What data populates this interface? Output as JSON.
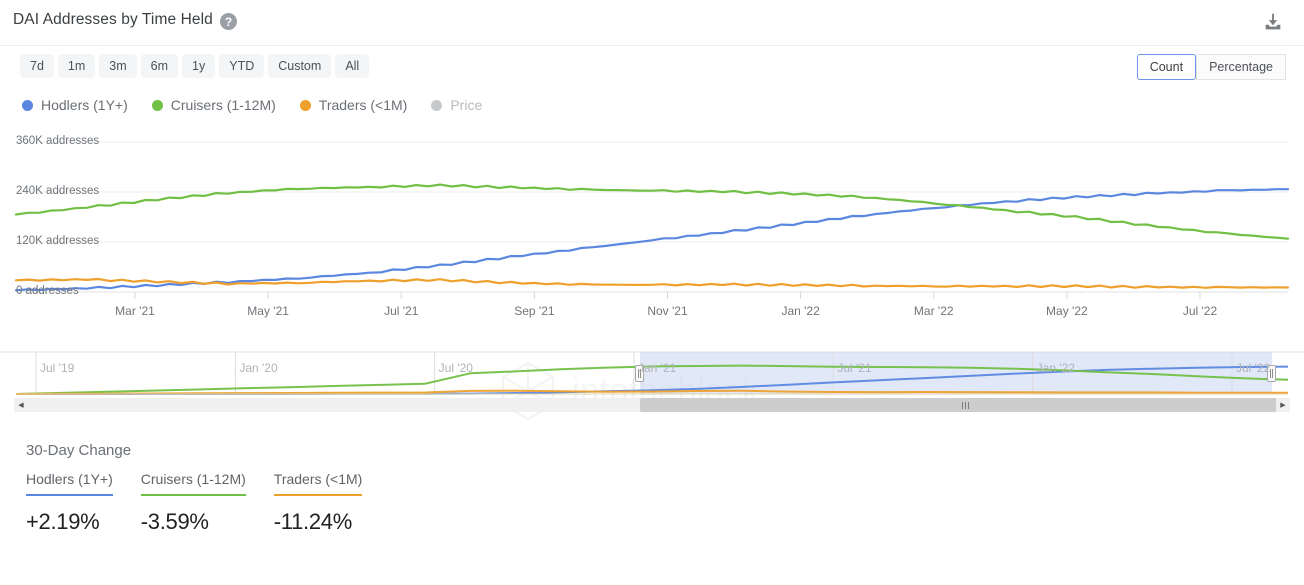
{
  "header": {
    "title": "DAI Addresses by Time Held",
    "help_icon": "help-circle-icon",
    "help_glyph": "?",
    "download_icon": "download-icon"
  },
  "controls": {
    "ranges": [
      {
        "label": "7d"
      },
      {
        "label": "1m"
      },
      {
        "label": "3m"
      },
      {
        "label": "6m"
      },
      {
        "label": "1y"
      },
      {
        "label": "YTD"
      },
      {
        "label": "Custom"
      },
      {
        "label": "All"
      }
    ],
    "mode_toggle": {
      "options": [
        {
          "label": "Count",
          "active": true
        },
        {
          "label": "Percentage",
          "active": false
        }
      ]
    }
  },
  "legend": [
    {
      "label": "Hodlers (1Y+)",
      "color": "#5b87e0",
      "disabled": false
    },
    {
      "label": "Cruisers (1-12M)",
      "color": "#71bf44",
      "disabled": false
    },
    {
      "label": "Traders (<1M)",
      "color": "#efa02c",
      "disabled": false
    },
    {
      "label": "Price",
      "color": "#c6c9cc",
      "disabled": true
    }
  ],
  "watermark": {
    "text": "intotheblock",
    "logo": "intotheblock-cube-logo"
  },
  "chart_data": {
    "type": "line",
    "title": "DAI Addresses by Time Held",
    "xlabel": "",
    "ylabel": "addresses",
    "ylim": [
      0,
      360000
    ],
    "grid": true,
    "legend_position": "top-left",
    "ytick_labels": [
      "0 addresses",
      "120K addresses",
      "240K addresses",
      "360K addresses"
    ],
    "yticks": [
      0,
      120000,
      240000,
      360000
    ],
    "xtick_labels": [
      "Mar '21",
      "May '21",
      "Jul '21",
      "Sep '21",
      "Nov '21",
      "Jan '22",
      "Mar '22",
      "May '22",
      "Jul '22"
    ],
    "x": [
      "Feb '21",
      "Mar '21",
      "Apr '21",
      "May '21",
      "Jun '21",
      "Jul '21",
      "Aug '21",
      "Sep '21",
      "Oct '21",
      "Nov '21",
      "Dec '21",
      "Jan '22",
      "Feb '22",
      "Mar '22",
      "Apr '22",
      "May '22",
      "Jun '22",
      "Jul '22",
      "Aug '22"
    ],
    "series": [
      {
        "name": "Hodlers (1Y+)",
        "color": "#5b87e0",
        "values": [
          4000,
          9000,
          16000,
          24000,
          33000,
          46000,
          64000,
          84000,
          104000,
          124000,
          143000,
          163000,
          184000,
          202000,
          217000,
          228000,
          236000,
          243000,
          247000
        ]
      },
      {
        "name": "Cruisers (1-12M)",
        "color": "#71bf44",
        "values": [
          186000,
          203000,
          222000,
          238000,
          248000,
          252000,
          256000,
          251000,
          246000,
          243000,
          241000,
          236000,
          228000,
          213000,
          196000,
          180000,
          160000,
          142000,
          128000
        ]
      },
      {
        "name": "Traders (<1M)",
        "color": "#efa02c",
        "values": [
          28000,
          30000,
          25000,
          20000,
          22000,
          27000,
          29000,
          22000,
          18000,
          17000,
          18000,
          17000,
          15000,
          14000,
          14000,
          14000,
          12000,
          11000,
          11000
        ]
      }
    ]
  },
  "navigator": {
    "xtick_labels": [
      "Jul '19",
      "Jan '20",
      "Jul '20",
      "Jan '21",
      "Jul '21",
      "Jan '22",
      "Jul '22"
    ],
    "selection": {
      "start_label": "Jan '21",
      "end_label": "Jul '22"
    },
    "left_handle": "navigator-left-handle",
    "right_handle": "navigator-right-handle",
    "scrollbar": {
      "left_arrow": "scroll-left-arrow",
      "right_arrow": "scroll-right-arrow",
      "thumb": "scrollbar-thumb"
    }
  },
  "footer": {
    "title": "30-Day Change",
    "stats": [
      {
        "label": "Hodlers (1Y+)",
        "value": "+2.19%",
        "color": "#5b87e0"
      },
      {
        "label": "Cruisers (1-12M)",
        "value": "-3.59%",
        "color": "#71bf44"
      },
      {
        "label": "Traders (<1M)",
        "value": "-11.24%",
        "color": "#efa02c"
      }
    ]
  }
}
